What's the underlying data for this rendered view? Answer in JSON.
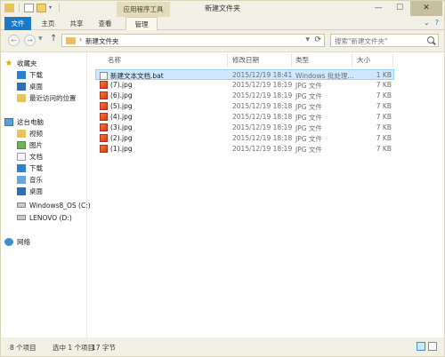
{
  "window": {
    "title": "新建文件夹",
    "context_tab": "应用程序工具",
    "controls": {
      "minimize": "—",
      "maximize": "☐",
      "close": "✕"
    }
  },
  "ribbon": {
    "tabs": [
      "文件",
      "主页",
      "共享",
      "查看",
      "管理"
    ],
    "right_icons": [
      "chevron-down-icon",
      "help-icon"
    ]
  },
  "navigation": {
    "back": "←",
    "forward": "→",
    "up": "↑",
    "path_separator": "›",
    "path": "新建文件夹",
    "search_placeholder": "搜索\"新建文件夹\""
  },
  "sidebar": {
    "favorites_label": "收藏夹",
    "favorites": [
      "下载",
      "桌面",
      "最近访问的位置"
    ],
    "pc_label": "这台电脑",
    "pc_items": [
      "视频",
      "图片",
      "文档",
      "下载",
      "音乐",
      "桌面",
      "Windows8_OS (C:)",
      "LENOVO (D:)"
    ],
    "network_label": "网络"
  },
  "file_list": {
    "columns": [
      "名称",
      "修改日期",
      "类型",
      "大小"
    ],
    "rows": [
      {
        "name": "新建文本文档.bat",
        "date": "2015/12/19 18:41",
        "type": "Windows 批处理...",
        "size": "1 KB",
        "icon": "bat-file-icon",
        "selected": true
      },
      {
        "name": "(7).jpg",
        "date": "2015/12/19 18:19",
        "type": "JPG 文件",
        "size": "7 KB",
        "icon": "jpg-file-icon",
        "selected": false
      },
      {
        "name": "(6).jpg",
        "date": "2015/12/19 18:19",
        "type": "JPG 文件",
        "size": "7 KB",
        "icon": "jpg-file-icon",
        "selected": false
      },
      {
        "name": "(5).jpg",
        "date": "2015/12/19 18:18",
        "type": "JPG 文件",
        "size": "7 KB",
        "icon": "jpg-file-icon",
        "selected": false
      },
      {
        "name": "(4).jpg",
        "date": "2015/12/19 18:18",
        "type": "JPG 文件",
        "size": "7 KB",
        "icon": "jpg-file-icon",
        "selected": false
      },
      {
        "name": "(3).jpg",
        "date": "2015/12/19 18:19",
        "type": "JPG 文件",
        "size": "7 KB",
        "icon": "jpg-file-icon",
        "selected": false
      },
      {
        "name": "(2).jpg",
        "date": "2015/12/19 18:18",
        "type": "JPG 文件",
        "size": "7 KB",
        "icon": "jpg-file-icon",
        "selected": false
      },
      {
        "name": "(1).jpg",
        "date": "2015/12/19 18:19",
        "type": "JPG 文件",
        "size": "7 KB",
        "icon": "jpg-file-icon",
        "selected": false
      }
    ]
  },
  "status_bar": {
    "item_count": "8 个项目",
    "selection": "选中 1 个项目",
    "selection_size": "17 字节"
  },
  "colors": {
    "accent": "#1979ca",
    "selection_bg": "#cde8ff",
    "selection_border": "#99d1ff",
    "chrome_bg": "#f2f0e4"
  }
}
